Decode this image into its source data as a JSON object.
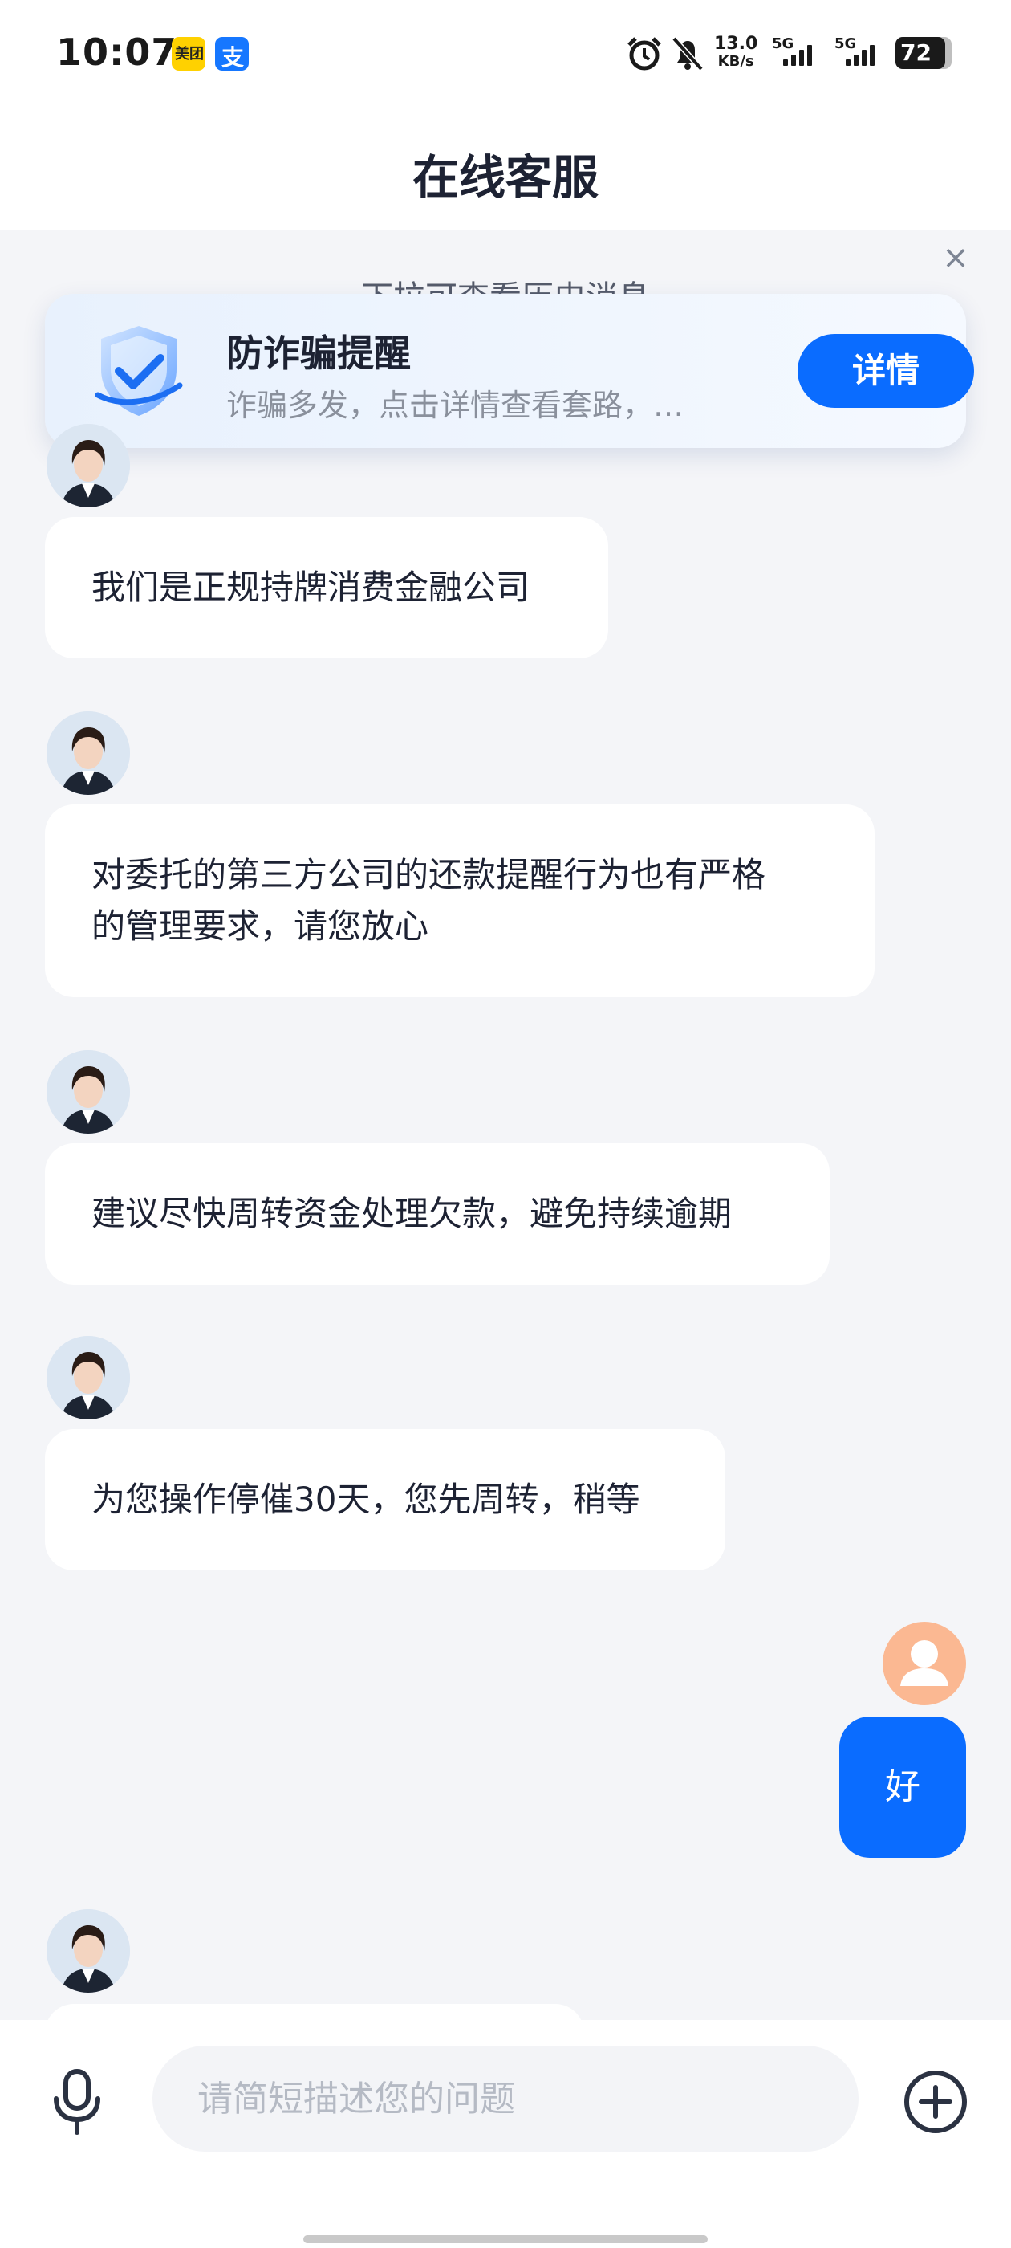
{
  "status_bar": {
    "time": "10:07",
    "app_icons": [
      {
        "name": "meituan-icon",
        "label": "美团"
      },
      {
        "name": "alipay-icon",
        "label": "支"
      }
    ],
    "net_speed_value": "13.0",
    "net_speed_unit": "KB/s",
    "signal_1": "5G",
    "signal_2": "5G",
    "battery": "72"
  },
  "header": {
    "title": "在线客服"
  },
  "chat": {
    "history_hint": "下拉可查看历史消息",
    "anti_fraud": {
      "title": "防诈骗提醒",
      "description": "诈骗多发，点击详情查看套路，…",
      "button": "详情"
    },
    "messages": [
      {
        "from": "agent",
        "lines": [
          "我们是正规持牌消费金融公司"
        ]
      },
      {
        "from": "agent",
        "lines": [
          "对委托的第三方公司的还款提醒行为也有严格",
          "的管理要求，请您放心"
        ]
      },
      {
        "from": "agent",
        "lines": [
          "建议尽快周转资金处理欠款，避免持续逾期"
        ]
      },
      {
        "from": "agent",
        "lines": [
          "为您操作停催30天，您先周转，稍等"
        ]
      },
      {
        "from": "user",
        "lines": [
          "好"
        ]
      }
    ]
  },
  "input_bar": {
    "placeholder": "请简短描述您的问题",
    "value": ""
  },
  "colors": {
    "accent": "#0a6cff",
    "background": "#f4f5f8",
    "user_avatar": "#fbb892"
  }
}
